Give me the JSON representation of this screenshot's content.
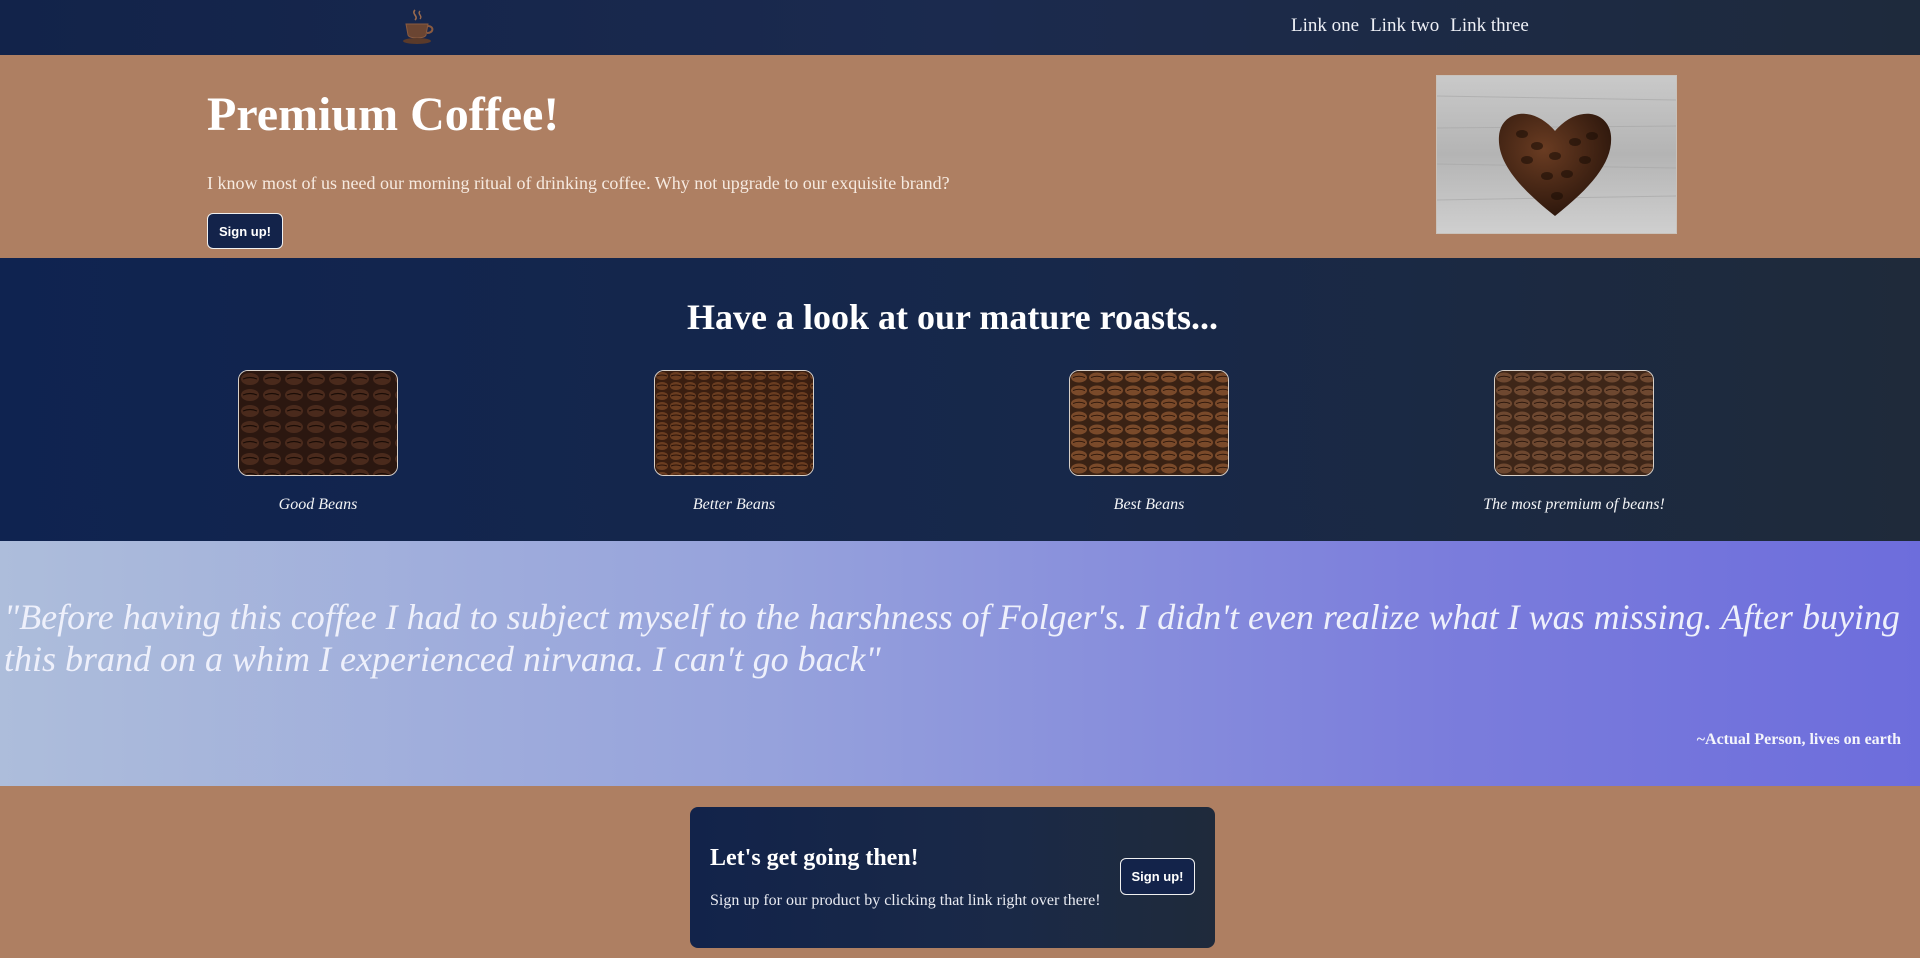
{
  "nav": {
    "logo_icon": "coffee-cup-icon",
    "links": [
      "Link one",
      "Link two",
      "Link three"
    ]
  },
  "hero": {
    "title": "Premium Coffee!",
    "description": "I know most of us need our morning ritual of drinking coffee. Why not upgrade to our exquisite brand?",
    "button_label": "Sign up!",
    "image": "coffee-bean-heart-image"
  },
  "roasts": {
    "title": "Have a look at our mature roasts...",
    "items": [
      {
        "caption": "Good Beans",
        "image": "coffee-beans-image"
      },
      {
        "caption": "Better Beans",
        "image": "coffee-beans-image"
      },
      {
        "caption": "Best Beans",
        "image": "coffee-beans-image"
      },
      {
        "caption": "The most premium of beans!",
        "image": "coffee-beans-image"
      }
    ]
  },
  "testimonial": {
    "quote": "\"Before having this coffee I had to subject myself to the harshness of Folger's. I didn't even realize what I was missing. After buying this brand on a whim I experienced nirvana. I can't go back\"",
    "author": "~Actual Person, lives on earth"
  },
  "cta": {
    "title": "Let's get going then!",
    "description": "Sign up for our product by clicking that link right over there!",
    "button_label": "Sign up!"
  },
  "colors": {
    "nav_bg": "#12234a",
    "tan": "#ae7f62",
    "testimonial_start": "#adbddb",
    "testimonial_end": "#6d6ddc"
  }
}
